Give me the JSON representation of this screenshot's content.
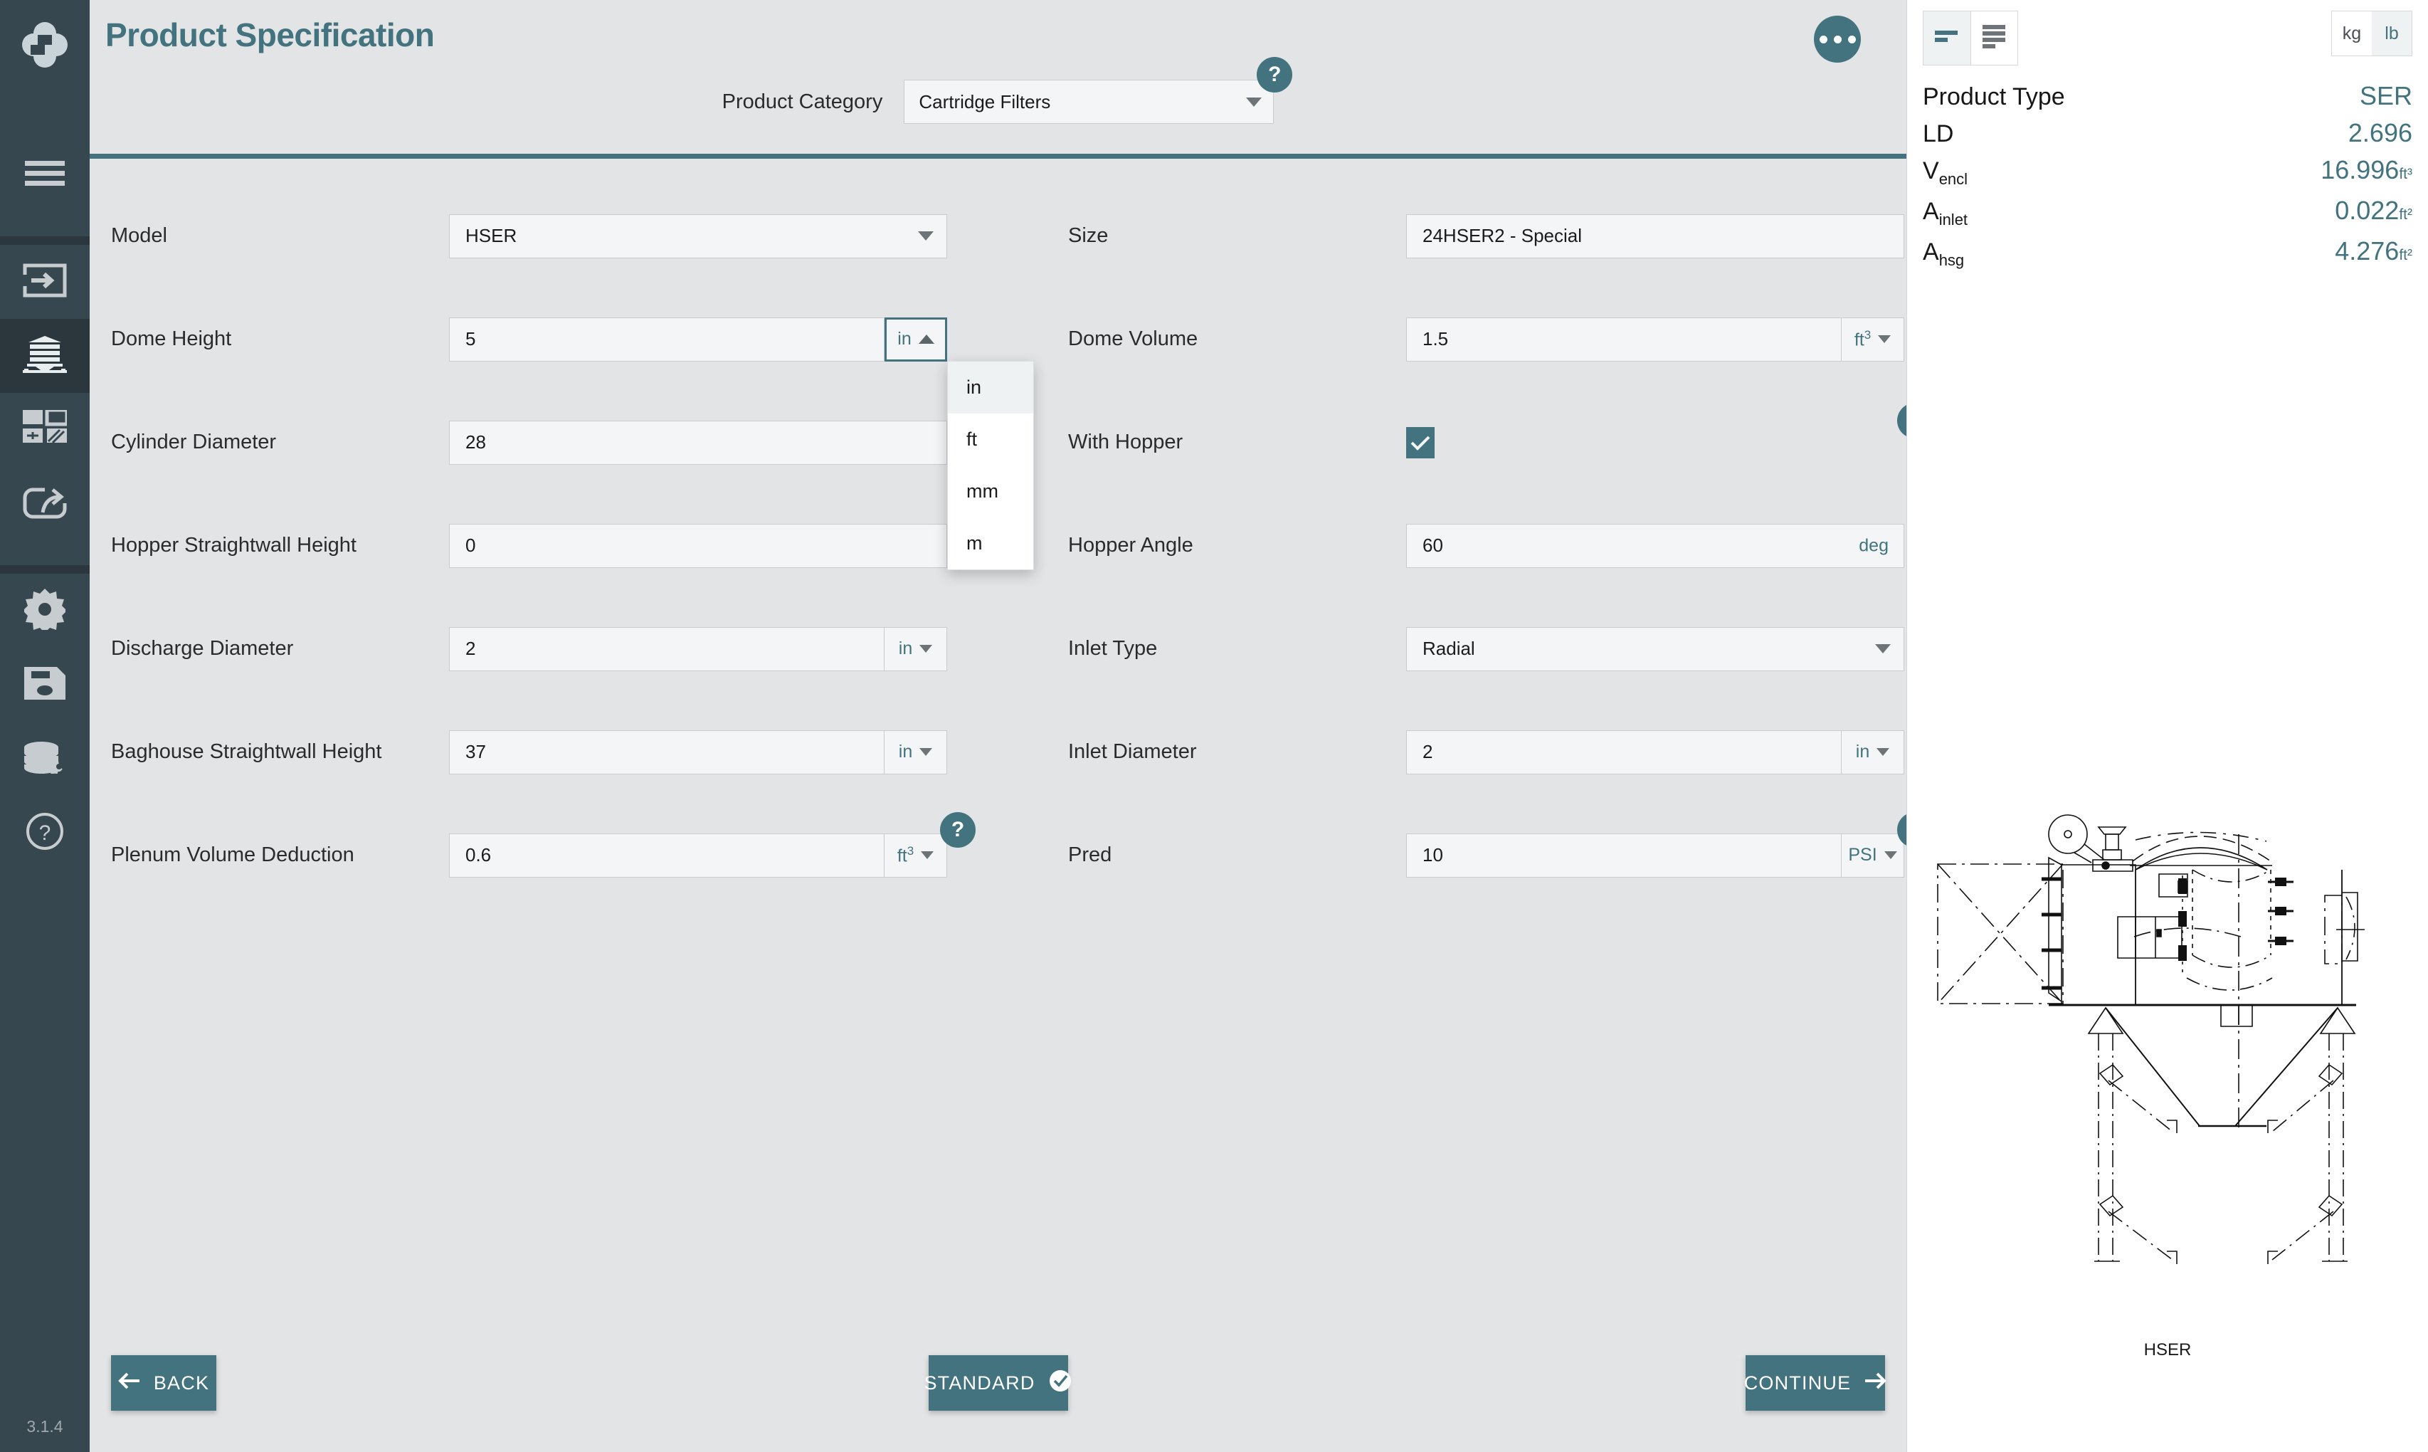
{
  "sidebar": {
    "logo_name": "app-logo",
    "version": "3.1.4",
    "items": [
      {
        "name": "menu-toggle",
        "icon": "hamburger-icon"
      },
      {
        "name": "sidebar-item-import",
        "icon": "import-arrow-icon"
      },
      {
        "name": "sidebar-item-product",
        "icon": "silo-baghouse-icon",
        "active": true
      },
      {
        "name": "sidebar-item-layout",
        "icon": "grid-layout-icon"
      },
      {
        "name": "sidebar-item-export",
        "icon": "share-export-icon"
      },
      {
        "name": "sidebar-item-settings",
        "icon": "gear-icon"
      },
      {
        "name": "sidebar-item-save",
        "icon": "floppy-save-icon"
      },
      {
        "name": "sidebar-item-database",
        "icon": "database-gear-icon"
      },
      {
        "name": "sidebar-item-help",
        "icon": "question-circle-icon"
      }
    ]
  },
  "header": {
    "title": "Product Specification",
    "kebab_label": "more-options",
    "category_label": "Product Category",
    "category_value": "Cartridge Filters",
    "category_help": "?"
  },
  "form": {
    "left": [
      {
        "label": "Model",
        "type": "select",
        "value": "HSER"
      },
      {
        "label": "Dome Height",
        "type": "text-unit-open",
        "value": "5",
        "unit": "in"
      },
      {
        "label": "Cylinder Diameter",
        "type": "text",
        "value": "28"
      },
      {
        "label": "Hopper Straightwall Height",
        "type": "text",
        "value": "0"
      },
      {
        "label": "Discharge Diameter",
        "type": "text-unit",
        "value": "2",
        "unit": "in"
      },
      {
        "label": "Baghouse Straightwall Height",
        "type": "text-unit",
        "value": "37",
        "unit": "in"
      },
      {
        "label": "Plenum Volume Deduction",
        "type": "text-unit",
        "value": "0.6",
        "unit": "ft",
        "unit_sup": "3",
        "help": "?"
      }
    ],
    "right": [
      {
        "label": "Size",
        "type": "plain",
        "value": "24HSER2 - Special"
      },
      {
        "label": "Dome Volume",
        "type": "text-unit",
        "value": "1.5",
        "unit": "ft",
        "unit_sup": "3"
      },
      {
        "label": "With Hopper",
        "type": "checkbox",
        "checked": true,
        "help": "?"
      },
      {
        "label": "Hopper Angle",
        "type": "text-inline-unit",
        "value": "60",
        "unit": "deg"
      },
      {
        "label": "Inlet Type",
        "type": "select",
        "value": "Radial"
      },
      {
        "label": "Inlet Diameter",
        "type": "text-unit",
        "value": "2",
        "unit": "in"
      },
      {
        "label": "Pred",
        "type": "text-unit",
        "value": "10",
        "unit": "PSI",
        "help": "?"
      }
    ]
  },
  "unit_dropdown": {
    "open_for": "Dome Height",
    "selected": "in",
    "options": [
      "in",
      "ft",
      "mm",
      "m"
    ]
  },
  "footer": {
    "back_label": "BACK",
    "back_icon": "arrow-left-icon",
    "standard_label": "STANDARD",
    "standard_icon": "check-circle-icon",
    "continue_label": "CONTINUE",
    "continue_icon": "arrow-right-icon"
  },
  "right_panel": {
    "view_toggle": [
      {
        "name": "compact-view-icon",
        "active": true
      },
      {
        "name": "list-view-icon",
        "active": false
      }
    ],
    "mass_units": [
      {
        "label": "kg",
        "active": false
      },
      {
        "label": "lb",
        "active": true
      }
    ],
    "results": [
      {
        "key": "Product Type",
        "sub": "",
        "value": "SER",
        "unit": ""
      },
      {
        "key": "LD",
        "sub": "",
        "value": "2.696",
        "unit": ""
      },
      {
        "key": "V",
        "sub": "encl",
        "value": "16.996",
        "unit": "ft³"
      },
      {
        "key": "A",
        "sub": "inlet",
        "value": "0.022",
        "unit": "ft²"
      },
      {
        "key": "A",
        "sub": "hsg",
        "value": "4.276",
        "unit": "ft²"
      }
    ],
    "drawing_caption": "HSER",
    "drawing_name": "hser-dust-collector-technical-drawing"
  },
  "colors": {
    "accent": "#42737f",
    "sidebar": "#37474f",
    "page_bg": "#e2e4e6",
    "field_bg": "#f4f5f6"
  }
}
